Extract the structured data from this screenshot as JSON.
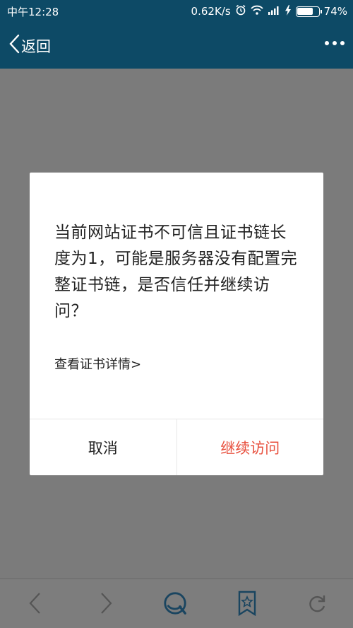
{
  "status_bar": {
    "time": "中午12:28",
    "network_speed": "0.62K/s",
    "battery_percent": "74%",
    "battery_level": 0.74,
    "icons": [
      "alarm-icon",
      "wifi-icon",
      "signal-icon",
      "charging-icon",
      "battery-icon"
    ]
  },
  "app_bar": {
    "back_label": "返回",
    "more_icon": "more-icon"
  },
  "dialog": {
    "message": "当前网站证书不可信且证书链长度为1，可能是服务器没有配置完整证书链，是否信任并继续访问？",
    "link": "查看证书详情>",
    "cancel_label": "取消",
    "continue_label": "继续访问",
    "continue_color": "#e8513f"
  },
  "bottom_bar": {
    "icons": [
      "back-arrow-icon",
      "forward-arrow-icon",
      "home-icon",
      "bookmark-star-icon",
      "refresh-icon"
    ]
  }
}
